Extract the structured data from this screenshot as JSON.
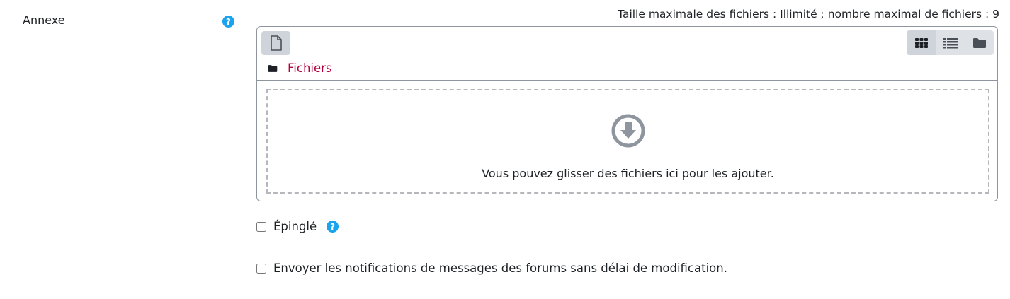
{
  "attachment": {
    "label": "Annexe",
    "help_icon": "question-circle-icon",
    "limits_text": "Taille maximale des fichiers : Illimité ; nombre maximal de fichiers : 9",
    "filepicker": {
      "add_file_icon": "file-icon",
      "view_buttons": [
        {
          "icon": "grid-icon",
          "active": true
        },
        {
          "icon": "list-icon",
          "active": false
        },
        {
          "icon": "folder-icon",
          "active": false
        }
      ],
      "path_icon": "folder-icon",
      "path_label": "Fichiers",
      "drop_icon": "download-arrow-circle-icon",
      "drop_text": "Vous pouvez glisser des fichiers ici pour les ajouter."
    }
  },
  "pinned": {
    "label": "Épinglé",
    "checked": false,
    "help_icon": "question-circle-icon"
  },
  "notify": {
    "label": "Envoyer les notifications de messages des forums sans délai de modification.",
    "checked": false
  },
  "colors": {
    "help_blue": "#1aa3ee",
    "link_red": "#b3003b",
    "border": "#8f959e"
  }
}
